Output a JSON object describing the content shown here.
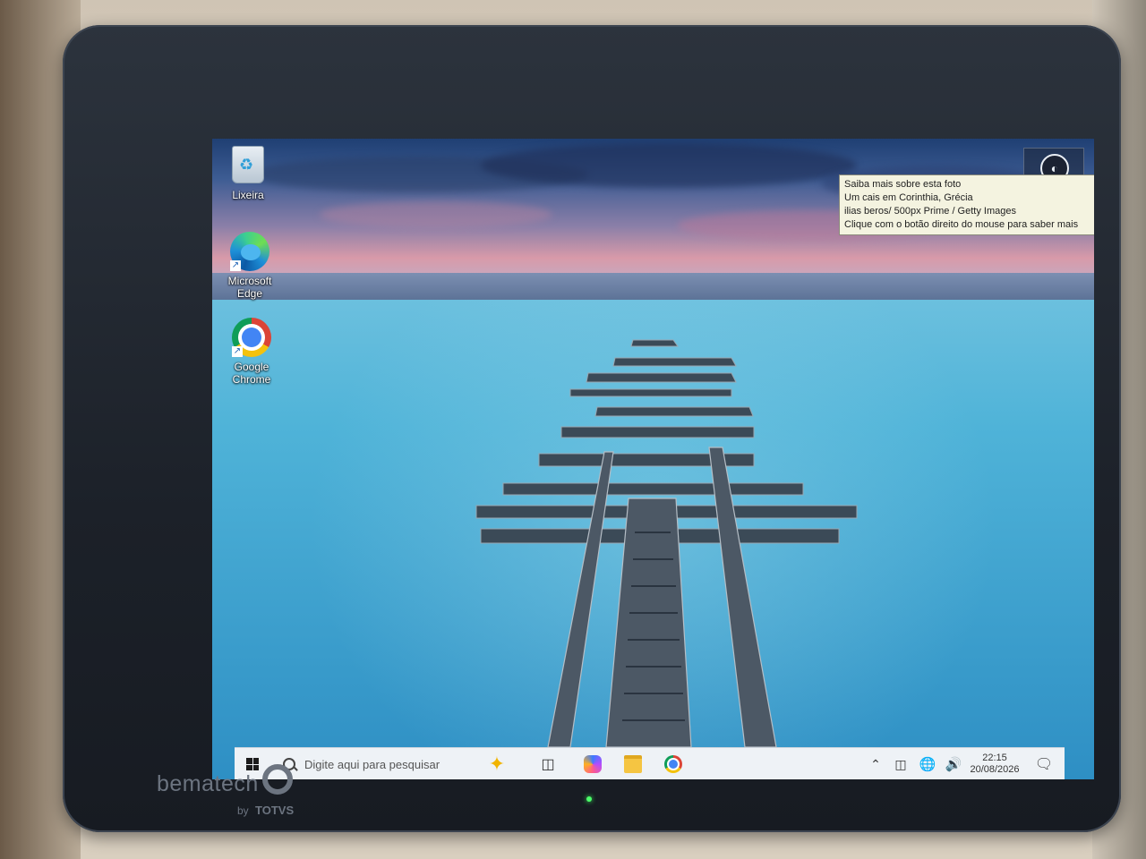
{
  "device": {
    "brand": "bematech",
    "brand_sub_prefix": "by",
    "brand_sub": "TOTVS"
  },
  "desktop": {
    "icons": [
      {
        "label": "Lixeira",
        "icon": "recycle-bin-icon"
      },
      {
        "label": "Microsoft Edge",
        "icon": "edge-icon"
      },
      {
        "label": "Google Chrome",
        "icon": "chrome-icon"
      }
    ],
    "spotlight_tooltip": {
      "line1": "Saiba mais sobre esta foto",
      "line2": "Um cais em Corinthia, Grécia",
      "line3": "ilias beros/ 500px Prime / Getty Images",
      "line4": "Clique com o botão direito do mouse para saber mais"
    }
  },
  "taskbar": {
    "search_placeholder": "Digite aqui para pesquisar",
    "pinned": [
      "copilot-icon",
      "file-explorer-icon",
      "chrome-icon"
    ],
    "clock": {
      "time": "22:15",
      "date": "20/08/2026"
    }
  },
  "colors": {
    "taskbar_bg": "#eef2f6",
    "tooltip_bg": "#f4f3e0",
    "bezel": "#1c2129"
  }
}
